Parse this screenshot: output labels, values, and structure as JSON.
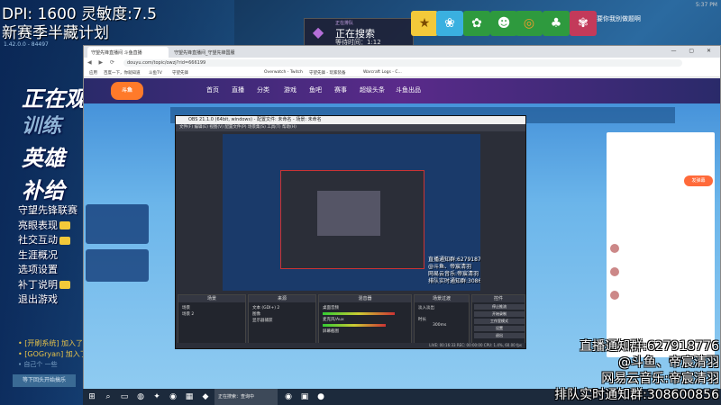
{
  "overlay_top": {
    "dpi_text": "DPI:   1600  灵敏度:7.5",
    "stream_title": "新赛季半藏计划",
    "version": "1.42.0.0 - 84497"
  },
  "ow_menu": {
    "items_big": [
      "正在观",
      "训练",
      "英雄",
      "补给"
    ],
    "items": [
      "守望先锋联赛",
      "英雄",
      "社交",
      "生涯概况",
      "选项设置",
      "补丁说明",
      "退出游戏"
    ],
    "items_full": [
      "守望先锋联赛",
      "亮眼表现",
      "社交互动",
      "生涯概况",
      "选项设置",
      "补丁说明",
      "退出游戏"
    ],
    "chat": [
      "• [开刷系统] 加入了比赛",
      "• [GOGryan] 加入了比赛",
      "• 自己个 一些"
    ],
    "join_btn": "等下回头开始搞乐"
  },
  "search_overlay": {
    "small_label": "正在排队",
    "main_label": "正在搜索",
    "time_label": "等待时间：1:12"
  },
  "top_tiles": {
    "notif_label": "要你我别做题啊",
    "clock": "5:37 PM"
  },
  "browser": {
    "tabs": [
      "守望先锋直播间 斗鱼直播",
      "守望先锋直播间_守望先锋国服"
    ],
    "url": "douyu.com/topic/owzj?rid=666199",
    "bookmarks": [
      "应用",
      "百度一下，你就知道",
      "斗鱼TV",
      "守望先锋",
      "Overwatch - Twitch",
      "守望先锋 - 玩家装备",
      "Warcraft Logs - C..."
    ],
    "site_nav": [
      "首页",
      "直播",
      "分类",
      "游戏",
      "鱼吧",
      "赛事",
      "超级头条",
      "斗鱼出品"
    ],
    "site_logo": "斗鱼",
    "chat_btn": "发弹幕"
  },
  "obs": {
    "title": "OBS 21.1.0 (64bit, windows) - 配置文件: 未命名 - 场景: 未命名",
    "menu": "文件(F)    编辑(E)    视图(V)    配置文件(P)    场景集(S)    工具(T)    帮助(H)",
    "docks": {
      "scenes": "场景",
      "sources": "来源",
      "mixer": "混音器",
      "transitions": "场景过渡",
      "controls": "控件"
    },
    "scene_items": [
      "场景",
      "场景 2"
    ],
    "source_items": [
      "文本 (GDI+) 2",
      "图像",
      "显示器捕获"
    ],
    "mixer_items": [
      "桌面音频",
      "麦克风/Aux",
      "屏幕截图"
    ],
    "transition_items": [
      "淡入淡出",
      "时长",
      "300ms"
    ],
    "control_buttons": [
      "停止推流",
      "开始录制",
      "工作室模式",
      "设置",
      "退出"
    ],
    "status": "LIVE: 00:16:33   REC: 00:00:00   CPU: 1.4%, 60.00 fps",
    "preview_notif": [
      "直播通知群:627918776",
      "@斗鱼、帝宸清羽",
      "网易云音乐:帝宸清羽",
      "排队实时通知群:30860856"
    ]
  },
  "taskbar": {
    "search_text": "正在搜索：查询中",
    "right": "英"
  },
  "overlay_bottom": {
    "lines": [
      "直播通知群:627918776",
      "@斗鱼、帝宸清羽",
      "网易云音乐:帝宸清羽",
      "排队实时通知群:308600856"
    ]
  }
}
